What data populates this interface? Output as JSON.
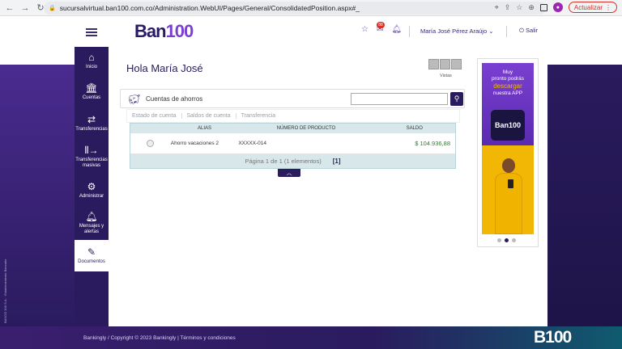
{
  "browser": {
    "url": "sucursalvirtual.ban100.com.co/Administration.WebUI/Pages/General/ConsolidatedPosition.aspx#_",
    "update_label": "Actualizar"
  },
  "header": {
    "logo_main": "Ban",
    "logo_num": "100",
    "notification_count": "88",
    "user_name": "María José Pérez Araújo",
    "logout_label": "Salir"
  },
  "sidebar": {
    "items": [
      {
        "label": "Inicio",
        "icon": "home-icon"
      },
      {
        "label": "Cuentas",
        "icon": "bank-icon"
      },
      {
        "label": "Transferencias",
        "icon": "transfer-icon"
      },
      {
        "label": "Transferencias masivas",
        "icon": "bulk-transfer-icon"
      },
      {
        "label": "Administrar",
        "icon": "gear-icon"
      },
      {
        "label": "Mensajes y alertas",
        "icon": "bell-icon"
      },
      {
        "label": "Documentos",
        "icon": "document-edit-icon"
      }
    ]
  },
  "main": {
    "greeting": "Hola María José",
    "views_label": "Vistas",
    "account_section_title": "Cuentas de ahorros",
    "subtabs": [
      "Estado de cuenta",
      "Saldos de cuenta",
      "Transferencia"
    ],
    "table": {
      "headers": [
        "ALIAS",
        "NÚMERO DE PRODUCTO",
        "SALDO"
      ],
      "rows": [
        {
          "alias": "Ahorro vacaciones 2",
          "product_number": "XXXXX-014",
          "balance": "$ 104.936,88"
        }
      ],
      "pagination_text": "Página 1 de 1 (1 elementos)",
      "page_link": "[1]"
    }
  },
  "ad": {
    "line1": "Muy",
    "line2": "pronto podrás",
    "line3": "descargar",
    "line4": "nuestra APP",
    "logo_text": "Ban100"
  },
  "footer": {
    "copyright": "Bankingly / Copyright © 2023 Bankingly  |  Términos y condiciones",
    "logo": "B100"
  },
  "side_vertical_text": "BANCO 100 S.A. · Establecimiento Bancario"
}
